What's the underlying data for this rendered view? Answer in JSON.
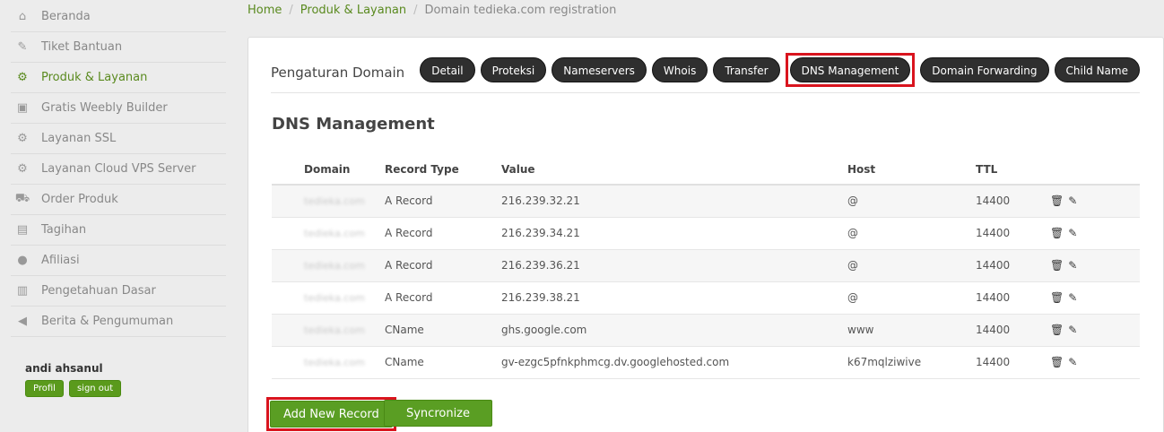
{
  "sidebar": {
    "items": [
      {
        "label": "Beranda",
        "icon": "home-icon",
        "glyph": "⌂"
      },
      {
        "label": "Tiket Bantuan",
        "icon": "wrench-icon",
        "glyph": "✎"
      },
      {
        "label": "Produk & Layanan",
        "icon": "cogs-icon",
        "glyph": "⚙"
      },
      {
        "label": "Gratis Weebly Builder",
        "icon": "gift-icon",
        "glyph": "▣"
      },
      {
        "label": "Layanan SSL",
        "icon": "cogs-icon",
        "glyph": "⚙"
      },
      {
        "label": "Layanan Cloud VPS Server",
        "icon": "cogs-icon",
        "glyph": "⚙"
      },
      {
        "label": "Order Produk",
        "icon": "cart-icon",
        "glyph": "⛟"
      },
      {
        "label": "Tagihan",
        "icon": "file-icon",
        "glyph": "▤"
      },
      {
        "label": "Afiliasi",
        "icon": "chat-icon",
        "glyph": "●"
      },
      {
        "label": "Pengetahuan Dasar",
        "icon": "book-icon",
        "glyph": "▥"
      },
      {
        "label": "Berita & Pengumuman",
        "icon": "bullhorn-icon",
        "glyph": "◀"
      }
    ],
    "user": {
      "name": "andi ahsanul",
      "profile_label": "Profil",
      "signout_label": "sign out"
    }
  },
  "breadcrumb": {
    "home": "Home",
    "products": "Produk & Layanan",
    "current": "Domain tedieka.com registration"
  },
  "panel": {
    "title": "Pengaturan Domain",
    "tabs": [
      "Detail",
      "Proteksi",
      "Nameservers",
      "Whois",
      "Transfer",
      "DNS Management",
      "Domain Forwarding",
      "Child Name"
    ],
    "section_title": "DNS Management"
  },
  "table": {
    "headers": {
      "domain": "Domain",
      "type": "Record Type",
      "value": "Value",
      "host": "Host",
      "ttl": "TTL"
    },
    "rows": [
      {
        "domain": "tedieka.com",
        "type": "A Record",
        "value": "216.239.32.21",
        "host": "@",
        "ttl": "14400"
      },
      {
        "domain": "tedieka.com",
        "type": "A Record",
        "value": "216.239.34.21",
        "host": "@",
        "ttl": "14400"
      },
      {
        "domain": "tedieka.com",
        "type": "A Record",
        "value": "216.239.36.21",
        "host": "@",
        "ttl": "14400"
      },
      {
        "domain": "tedieka.com",
        "type": "A Record",
        "value": "216.239.38.21",
        "host": "@",
        "ttl": "14400"
      },
      {
        "domain": "tedieka.com",
        "type": "CName",
        "value": "ghs.google.com",
        "host": "www",
        "ttl": "14400"
      },
      {
        "domain": "tedieka.com",
        "type": "CName",
        "value": "gv-ezgc5pfnkphmcg.dv.googlehosted.com",
        "host": "k67mqlziwive",
        "ttl": "14400"
      }
    ]
  },
  "buttons": {
    "add": "Add New Record",
    "sync": "Syncronize"
  },
  "colors": {
    "accent_green": "#5a9a1c",
    "highlight_red": "#d9141e",
    "tab_dark": "#2f2f2f"
  }
}
